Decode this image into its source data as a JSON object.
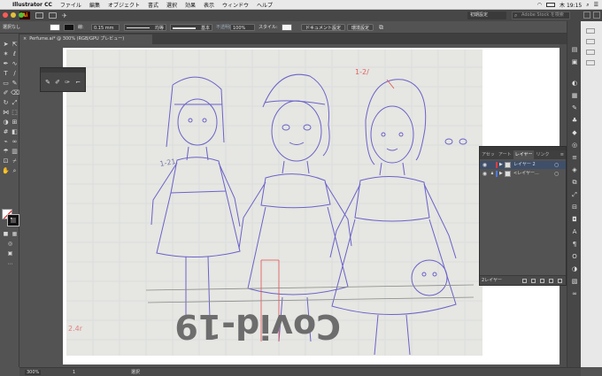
{
  "menubar": {
    "app_name": "Illustrator CC",
    "items": [
      "ファイル",
      "編集",
      "オブジェクト",
      "書式",
      "選択",
      "効果",
      "表示",
      "ウィンドウ",
      "ヘルプ"
    ],
    "clock": "木 19:15"
  },
  "appbar": {
    "logo": "Ai",
    "workspace": "初期設定",
    "stock_search_placeholder": "Adobe Stock を検索"
  },
  "controlbar": {
    "selection_label": "選択なし",
    "stroke_label": "線:",
    "stroke_weight": "0.15 mm",
    "brush_label": "均等",
    "brush2_label": "基本",
    "opacity_label": "不透明度:",
    "opacity_value": "100%",
    "style_label": "スタイル:",
    "doc_setup_button": "ドキュメント設定",
    "preferences_button": "環境設定"
  },
  "document": {
    "tab_title": "Perfume.ai* @ 300% (RGB/GPU プレビュー)"
  },
  "sketch": {
    "note_top": "1-2/",
    "note_mid": "1-21",
    "note_bottom": "2.4r",
    "stamp_text": "Covid-19"
  },
  "layers_panel": {
    "tabs": [
      "アセッ",
      "アート",
      "レイヤー",
      "リンク"
    ],
    "active_tab": "レイヤー",
    "layers": [
      {
        "name": "レイヤー 2",
        "color": "#e83a3a",
        "selected": true
      },
      {
        "name": "<レイヤー...",
        "color": "#4a7be0",
        "selected": false
      }
    ],
    "footer_label": "2レイヤー"
  },
  "statusbar": {
    "zoom": "300%",
    "page": "1",
    "tool": "選択"
  }
}
